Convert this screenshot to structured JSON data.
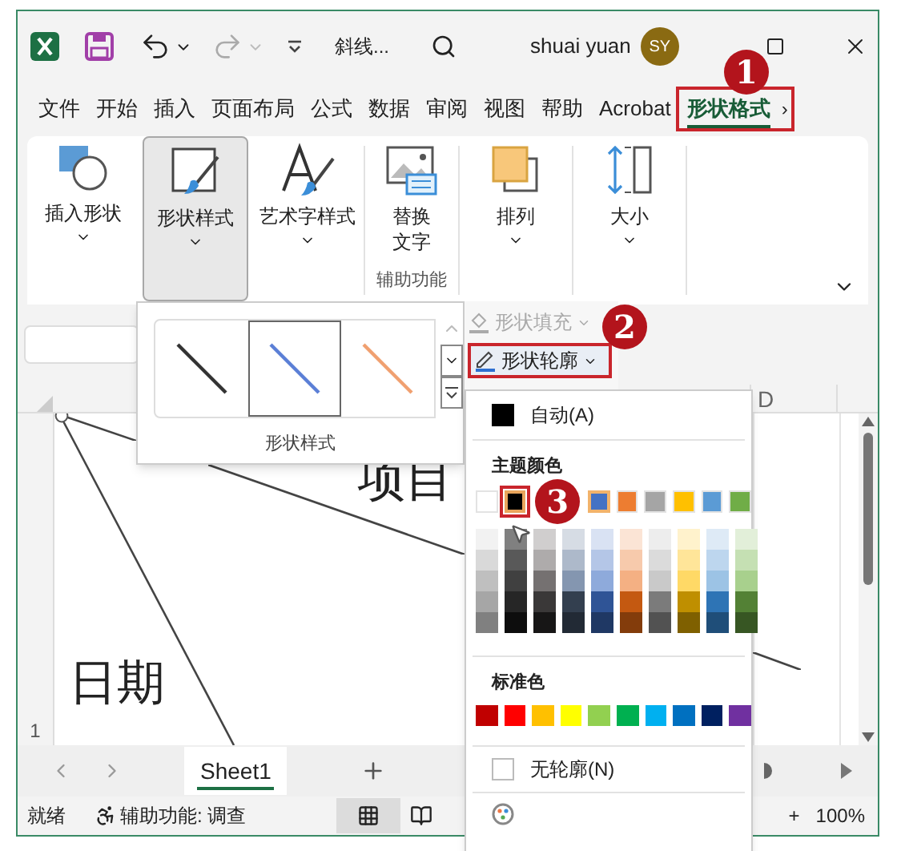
{
  "title_bar": {
    "title": "斜线...",
    "user": "shuai yuan",
    "avatar": "SY"
  },
  "tabs": [
    {
      "label": "文件",
      "selected": false,
      "annotated": false
    },
    {
      "label": "开始",
      "selected": false,
      "annotated": false
    },
    {
      "label": "插入",
      "selected": false,
      "annotated": false
    },
    {
      "label": "页面布局",
      "selected": false,
      "annotated": false
    },
    {
      "label": "公式",
      "selected": false,
      "annotated": false
    },
    {
      "label": "数据",
      "selected": false,
      "annotated": false
    },
    {
      "label": "审阅",
      "selected": false,
      "annotated": false
    },
    {
      "label": "视图",
      "selected": false,
      "annotated": false
    },
    {
      "label": "帮助",
      "selected": false,
      "annotated": false
    },
    {
      "label": "Acrobat",
      "selected": false,
      "annotated": false
    },
    {
      "label": "形状格式",
      "selected": true,
      "annotated": true
    }
  ],
  "tab_scroll": "›",
  "ribbon": {
    "buttons": [
      {
        "kind": "insert-shape",
        "label": "插入形状",
        "pressed": false
      },
      {
        "kind": "shape-style",
        "label": "形状样式",
        "pressed": true
      },
      {
        "kind": "wordart",
        "label": "艺术字样式",
        "pressed": false
      },
      {
        "kind": "alt-text",
        "label": "替换文字",
        "pressed": false,
        "group": "辅助功能"
      },
      {
        "kind": "arrange",
        "label": "排列",
        "pressed": false
      },
      {
        "kind": "size",
        "label": "大小",
        "pressed": false
      }
    ]
  },
  "style_gallery": {
    "styles": [
      {
        "color": "#333333",
        "selected": false
      },
      {
        "color": "#5b7fd6",
        "selected": true
      },
      {
        "color": "#f0a070",
        "selected": false
      }
    ],
    "label": "形状样式"
  },
  "shape_fill": {
    "label": "形状填充",
    "disabled": true
  },
  "shape_outline": {
    "label": "形状轮廓",
    "annotated": true
  },
  "color_menu": {
    "automatic": "自动(A)",
    "theme_header": "主题颜色",
    "theme_colors": [
      {
        "color": "#ffffff",
        "selected": false,
        "current": false
      },
      {
        "color": "#000000",
        "selected": true,
        "current": false
      },
      {
        "color": "#4472c4",
        "selected": false,
        "current": true
      },
      {
        "color": "#ed7d31",
        "selected": false,
        "current": false
      },
      {
        "color": "#a5a5a5",
        "selected": false,
        "current": false
      },
      {
        "color": "#ffc000",
        "selected": false,
        "current": false
      },
      {
        "color": "#5b9bd5",
        "selected": false,
        "current": false
      },
      {
        "color": "#70ad47",
        "selected": false,
        "current": false
      }
    ],
    "shade_columns": [
      {
        "swatches": [
          {
            "color": "#f2f2f2"
          },
          {
            "color": "#d9d9d9"
          },
          {
            "color": "#bfbfbf"
          },
          {
            "color": "#a6a6a6"
          },
          {
            "color": "#808080"
          }
        ]
      },
      {
        "swatches": [
          {
            "color": "#808080"
          },
          {
            "color": "#595959"
          },
          {
            "color": "#404040"
          },
          {
            "color": "#262626"
          },
          {
            "color": "#0d0d0d"
          }
        ]
      },
      {
        "swatches": [
          {
            "color": "#d0cece"
          },
          {
            "color": "#aeabab"
          },
          {
            "color": "#757171"
          },
          {
            "color": "#3a3838"
          },
          {
            "color": "#171616"
          }
        ]
      },
      {
        "swatches": [
          {
            "color": "#d6dce4"
          },
          {
            "color": "#adb9ca"
          },
          {
            "color": "#8496b0"
          },
          {
            "color": "#333f4f"
          },
          {
            "color": "#222a35"
          }
        ]
      },
      {
        "swatches": [
          {
            "color": "#d9e2f3"
          },
          {
            "color": "#b4c6e7"
          },
          {
            "color": "#8eaadb"
          },
          {
            "color": "#2f5496"
          },
          {
            "color": "#1f3864"
          }
        ]
      },
      {
        "swatches": [
          {
            "color": "#fbe4d5"
          },
          {
            "color": "#f7caac"
          },
          {
            "color": "#f4b083"
          },
          {
            "color": "#c45911"
          },
          {
            "color": "#833c0b"
          }
        ]
      },
      {
        "swatches": [
          {
            "color": "#ededed"
          },
          {
            "color": "#dbdbdb"
          },
          {
            "color": "#c9c9c9"
          },
          {
            "color": "#7b7b7b"
          },
          {
            "color": "#525252"
          }
        ]
      },
      {
        "swatches": [
          {
            "color": "#fff2cc"
          },
          {
            "color": "#ffe599"
          },
          {
            "color": "#ffd966"
          },
          {
            "color": "#bf8f00"
          },
          {
            "color": "#7f6000"
          }
        ]
      },
      {
        "swatches": [
          {
            "color": "#deeaf6"
          },
          {
            "color": "#bdd6ee"
          },
          {
            "color": "#9cc3e5"
          },
          {
            "color": "#2e74b5"
          },
          {
            "color": "#1f4e79"
          }
        ]
      },
      {
        "swatches": [
          {
            "color": "#e2efd9"
          },
          {
            "color": "#c5e0b3"
          },
          {
            "color": "#a8d08d"
          },
          {
            "color": "#538135"
          },
          {
            "color": "#375623"
          }
        ]
      }
    ],
    "standard_header": "标准色",
    "standard_colors": [
      {
        "color": "#c00000"
      },
      {
        "color": "#ff0000"
      },
      {
        "color": "#ffc000"
      },
      {
        "color": "#ffff00"
      },
      {
        "color": "#92d050"
      },
      {
        "color": "#00b050"
      },
      {
        "color": "#00b0f0"
      },
      {
        "color": "#0070c0"
      },
      {
        "color": "#002060"
      },
      {
        "color": "#7030a0"
      }
    ],
    "no_outline": "无轮廓(N)"
  },
  "sheet": {
    "column_headers": [
      "D"
    ],
    "row_headers": [
      "1"
    ],
    "cells": [
      "项目",
      "日期"
    ]
  },
  "sheet_tabs": [
    {
      "label": "Sheet1",
      "selected": true
    }
  ],
  "status_bar": {
    "ready": "就绪",
    "accessibility": "辅助功能: 调查",
    "zoom_in": "+",
    "zoom": "100%"
  },
  "annotations": [
    {
      "label": "1"
    },
    {
      "label": "2"
    },
    {
      "label": "3"
    }
  ]
}
